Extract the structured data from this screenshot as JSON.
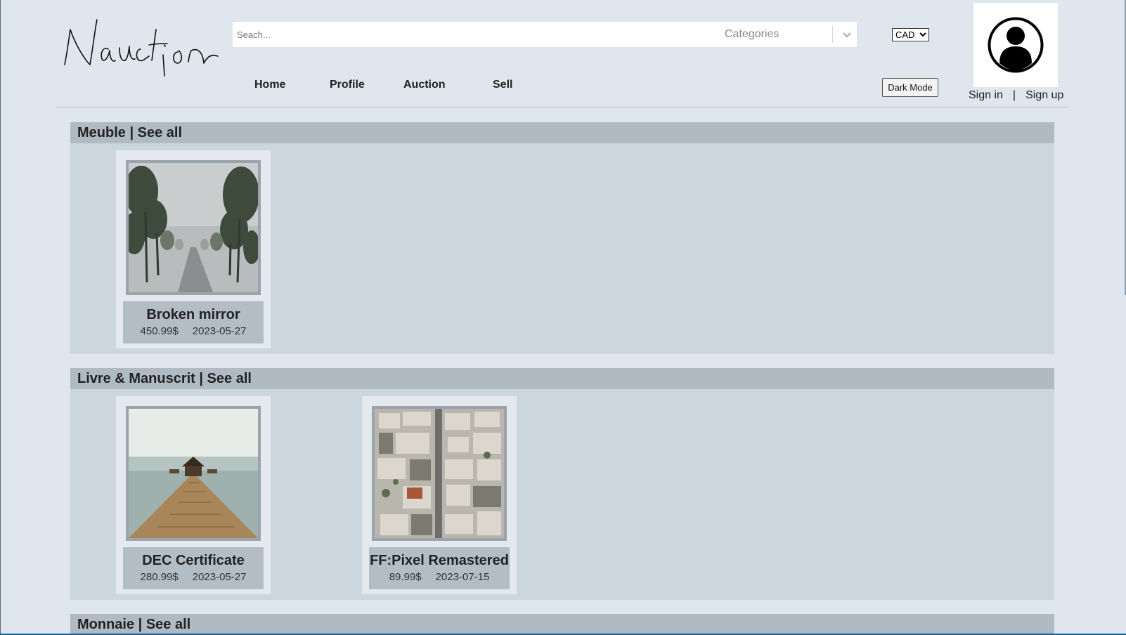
{
  "header": {
    "search_placeholder": "Seach...",
    "categories_label": "Categories",
    "currency": {
      "selected": "CAD",
      "options": [
        "CAD"
      ]
    },
    "nav": [
      "Home",
      "Profile",
      "Auction",
      "Sell"
    ],
    "dark_mode_label": "Dark Mode",
    "sign_in": "Sign in",
    "separator": "|",
    "sign_up": "Sign up",
    "avatar_icon": "user-avatar-icon"
  },
  "sections": [
    {
      "name": "Meuble",
      "separator": " | ",
      "see_all": "See all",
      "items": [
        {
          "title": "Broken mirror",
          "price": "450.99$",
          "date": "2023-05-27",
          "image": "foggy-tree-road"
        }
      ]
    },
    {
      "name": "Livre & Manuscrit",
      "separator": " | ",
      "see_all": "See all",
      "items": [
        {
          "title": "DEC Certificate",
          "price": "280.99$",
          "date": "2023-05-27",
          "image": "pier-gazebo-sea"
        },
        {
          "title": "FF:Pixel Remastered",
          "price": "89.99$",
          "date": "2023-07-15",
          "image": "aerial-city-houses"
        }
      ]
    },
    {
      "name": "Monnaie",
      "separator": " | ",
      "see_all": "See all",
      "items": []
    }
  ],
  "colors": {
    "page_bg": "#dfe6ed",
    "section_bg": "#cbd6de",
    "section_header": "#b0bac3",
    "card_bg": "#e3e9ef",
    "card_info": "#b3bdc6"
  }
}
